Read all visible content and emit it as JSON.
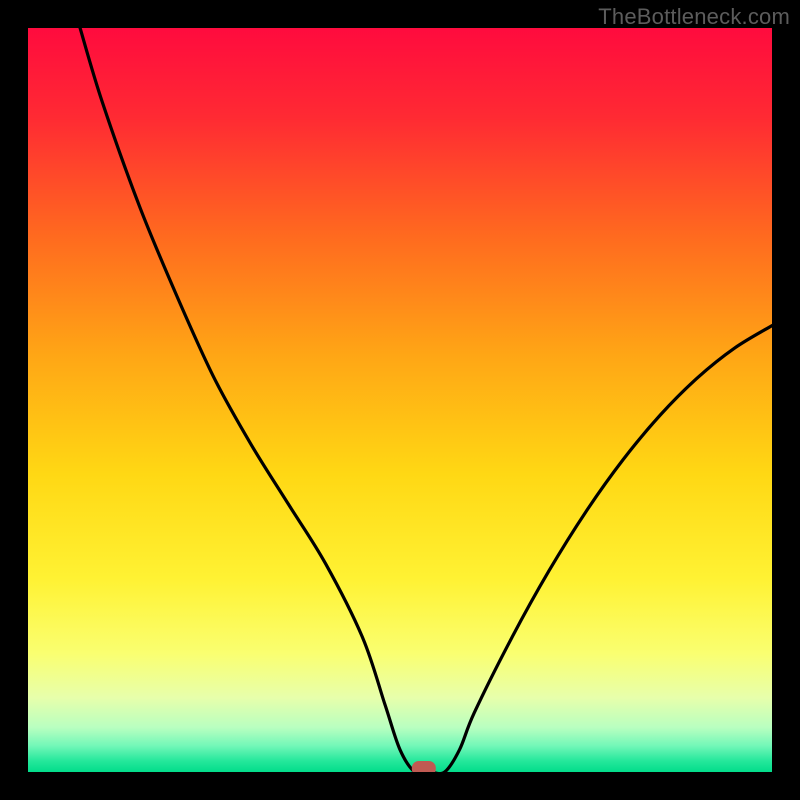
{
  "watermark": "TheBottleneck.com",
  "chart_data": {
    "type": "line",
    "title": "",
    "xlabel": "",
    "ylabel": "",
    "xlim": [
      0,
      100
    ],
    "ylim": [
      0,
      100
    ],
    "grid": false,
    "legend": false,
    "series": [
      {
        "name": "bottleneck-curve",
        "x": [
          7,
          10,
          15,
          20,
          25,
          30,
          35,
          40,
          45,
          48,
          50,
          52,
          54,
          56,
          58,
          60,
          65,
          70,
          75,
          80,
          85,
          90,
          95,
          100
        ],
        "y": [
          100,
          90,
          76,
          64,
          53,
          44,
          36,
          28,
          18,
          9,
          3,
          0,
          0,
          0,
          3,
          8,
          18,
          27,
          35,
          42,
          48,
          53,
          57,
          60
        ]
      }
    ],
    "annotations": [
      {
        "name": "optimum-marker",
        "shape": "rounded-rect",
        "x": 53.2,
        "y": 0,
        "color": "#c05a52"
      }
    ],
    "background_gradient": {
      "stops": [
        {
          "offset": 0.0,
          "color": "#ff0b3e"
        },
        {
          "offset": 0.12,
          "color": "#ff2a33"
        },
        {
          "offset": 0.28,
          "color": "#ff6a1f"
        },
        {
          "offset": 0.44,
          "color": "#ffa615"
        },
        {
          "offset": 0.6,
          "color": "#ffd814"
        },
        {
          "offset": 0.74,
          "color": "#fff233"
        },
        {
          "offset": 0.84,
          "color": "#faff70"
        },
        {
          "offset": 0.9,
          "color": "#e7ffab"
        },
        {
          "offset": 0.94,
          "color": "#b9ffc0"
        },
        {
          "offset": 0.965,
          "color": "#72f7b8"
        },
        {
          "offset": 0.985,
          "color": "#25e89b"
        },
        {
          "offset": 1.0,
          "color": "#02dd8b"
        }
      ]
    }
  }
}
